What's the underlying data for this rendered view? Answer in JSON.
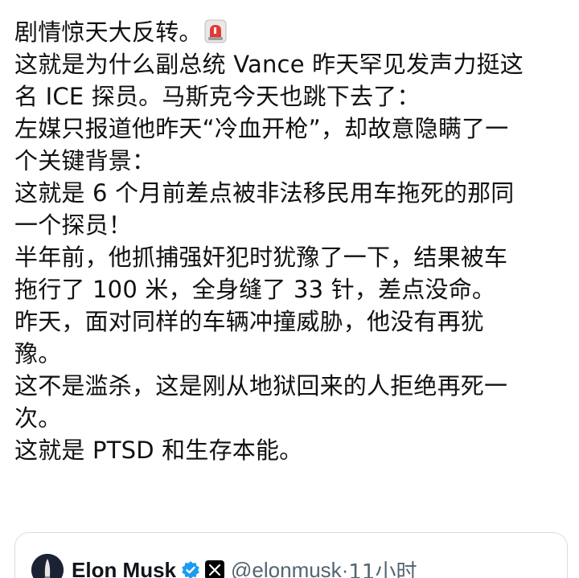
{
  "post": {
    "lines": [
      "剧情惊天大反转。",
      "这就是为什么副总统 Vance 昨天罕见发声力挺这",
      "名 ICE 探员。马斯克今天也跳下去了：",
      "左媒只报道他昨天“冷血开枪”，却故意隐瞒了一",
      "个关键背景：",
      "这就是 6 个月前差点被非法移民用车拖死的那同",
      "一个探员！",
      "半年前，他抓捕强奸犯时犹豫了一下，结果被车",
      "拖行了 100 米，全身缝了 33 针，差点没命。",
      "昨天，面对同样的车辆冲撞威胁，他没有再犹",
      "豫。",
      "这不是滥杀，这是刚从地狱回来的人拒绝再死一",
      "次。",
      "这就是 PTSD 和生存本能。"
    ],
    "emoji": "siren-icon"
  },
  "quote": {
    "name": "Elon Musk",
    "handle": "@elonmusk",
    "separator": "·",
    "time": "11小时",
    "verified_color": "#1d9bf0"
  }
}
